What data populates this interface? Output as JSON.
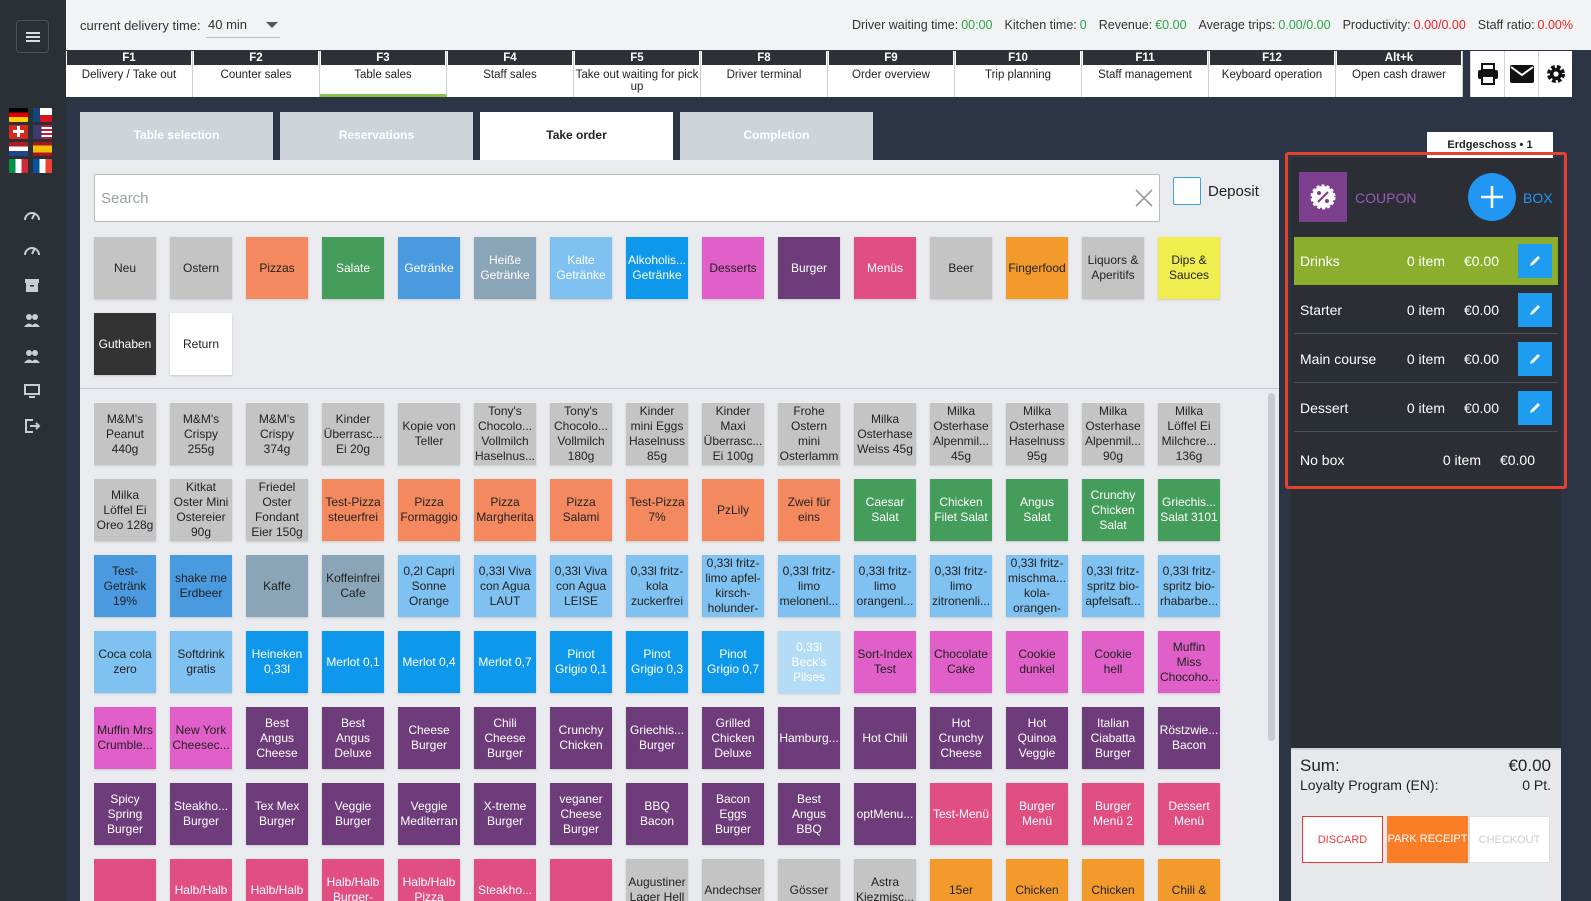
{
  "topbar": {
    "delivery_label": "current delivery time:",
    "delivery_value": "40 min",
    "stats": [
      {
        "label": "Driver waiting time:",
        "value": "00:00",
        "color": "#28a745"
      },
      {
        "label": "Kitchen time:",
        "value": "0",
        "color": "#28a745"
      },
      {
        "label": "Revenue:",
        "value": "€0.00",
        "color": "#28a745"
      },
      {
        "label": "Average trips:",
        "value": "0.00/0.00",
        "color": "#28a745"
      },
      {
        "label": "Productivity:",
        "value": "0.00/0.00",
        "color": "#e02424"
      },
      {
        "label": "Staff ratio:",
        "value": "0.00%",
        "color": "#e02424"
      }
    ]
  },
  "fkeys": [
    {
      "key": "F1",
      "label": "Delivery / Take out"
    },
    {
      "key": "F2",
      "label": "Counter sales"
    },
    {
      "key": "F3",
      "label": "Table sales",
      "active": true
    },
    {
      "key": "F4",
      "label": "Staff sales"
    },
    {
      "key": "F5",
      "label": "Take out waiting for pick up"
    },
    {
      "key": "F8",
      "label": "Driver terminal"
    },
    {
      "key": "F9",
      "label": "Order overview"
    },
    {
      "key": "F10",
      "label": "Trip planning"
    },
    {
      "key": "F11",
      "label": "Staff management"
    },
    {
      "key": "F12",
      "label": "Keyboard operation"
    },
    {
      "key": "Alt+k",
      "label": "Open cash drawer"
    }
  ],
  "top_icons": [
    "printer-icon",
    "mail-icon",
    "gear-icon"
  ],
  "sidebar": {
    "flags": [
      {
        "name": "flag-de",
        "colors": [
          "#000000",
          "#dd0000",
          "#ffce00"
        ],
        "dir": "h"
      },
      {
        "name": "flag-cz",
        "colors": [
          "#ffffff",
          "#d7141a"
        ],
        "dir": "cz"
      },
      {
        "name": "flag-ch",
        "colors": [
          "#d52b1e"
        ],
        "dir": "ch"
      },
      {
        "name": "flag-us",
        "colors": [
          "#b22234",
          "#ffffff",
          "#3c3b6e"
        ],
        "dir": "us"
      },
      {
        "name": "flag-nl",
        "colors": [
          "#ae1c28",
          "#ffffff",
          "#21468b"
        ],
        "dir": "h"
      },
      {
        "name": "flag-es",
        "colors": [
          "#aa151b",
          "#f1bf00",
          "#aa151b"
        ],
        "dir": "es"
      },
      {
        "name": "flag-it",
        "colors": [
          "#009246",
          "#ffffff",
          "#ce2b37"
        ],
        "dir": "v"
      },
      {
        "name": "flag-fr",
        "colors": [
          "#0055a4",
          "#ffffff",
          "#ef4135"
        ],
        "dir": "v"
      }
    ],
    "icons": [
      "speedometer-icon",
      "speedometer-icon",
      "archive-icon",
      "users-icon",
      "users-icon",
      "monitor-icon",
      "logout-icon"
    ]
  },
  "tabs": [
    {
      "label": "Table selection"
    },
    {
      "label": "Reservations"
    },
    {
      "label": "Take order",
      "active": true
    },
    {
      "label": "Completion"
    }
  ],
  "search": {
    "placeholder": "Search",
    "value": ""
  },
  "deposit_label": "Deposit",
  "categories": [
    {
      "label": "Neu",
      "bg": "#c4c4c4",
      "fg": "#222"
    },
    {
      "label": "Ostern",
      "bg": "#c4c4c4",
      "fg": "#222"
    },
    {
      "label": "Pizzas",
      "bg": "#f4895f",
      "fg": "#222"
    },
    {
      "label": "Salate",
      "bg": "#449d5a",
      "fg": "#fff"
    },
    {
      "label": "Getränke",
      "bg": "#4a9ae0",
      "fg": "#fff"
    },
    {
      "label": "Heiße Getränke",
      "bg": "#8aa5b8",
      "fg": "#fff"
    },
    {
      "label": "Kalte Getränke",
      "bg": "#7fc1f0",
      "fg": "#fff"
    },
    {
      "label": "Alkoholis... Getränke",
      "bg": "#0d98ec",
      "fg": "#fff"
    },
    {
      "label": "Desserts",
      "bg": "#e05fc8",
      "fg": "#222"
    },
    {
      "label": "Burger",
      "bg": "#6e3c7a",
      "fg": "#fff"
    },
    {
      "label": "Menüs",
      "bg": "#e04e82",
      "fg": "#fff"
    },
    {
      "label": "Beer",
      "bg": "#c4c4c4",
      "fg": "#222"
    },
    {
      "label": "Fingerfood",
      "bg": "#f39a2d",
      "fg": "#222"
    },
    {
      "label": "Liquors & Aperitifs",
      "bg": "#c4c4c4",
      "fg": "#222"
    },
    {
      "label": "Dips & Sauces",
      "bg": "#f0ee4e",
      "fg": "#222"
    },
    {
      "label": "Guthaben",
      "bg": "#333333",
      "fg": "#fff"
    },
    {
      "label": "Return",
      "bg": "#ffffff",
      "fg": "#222"
    }
  ],
  "products": [
    {
      "label": "M&M's Peanut 440g",
      "bg": "#c4c4c4",
      "fg": "#222"
    },
    {
      "label": "M&M's Crispy 255g",
      "bg": "#c4c4c4",
      "fg": "#222"
    },
    {
      "label": "M&M's Crispy 374g",
      "bg": "#c4c4c4",
      "fg": "#222"
    },
    {
      "label": "Kinder Überrasc... Ei 20g",
      "bg": "#c4c4c4",
      "fg": "#222"
    },
    {
      "label": "Kopie von Teller",
      "bg": "#c4c4c4",
      "fg": "#222"
    },
    {
      "label": "Tony's Chocolo... Vollmilch Haselnus...",
      "bg": "#c4c4c4",
      "fg": "#222"
    },
    {
      "label": "Tony's Chocolo... Vollmilch 180g",
      "bg": "#c4c4c4",
      "fg": "#222"
    },
    {
      "label": "Kinder mini Eggs Haselnuss 85g",
      "bg": "#c4c4c4",
      "fg": "#222"
    },
    {
      "label": "Kinder Maxi Überrasc... Ei 100g",
      "bg": "#c4c4c4",
      "fg": "#222"
    },
    {
      "label": "Frohe Ostern mini Osterlamm",
      "bg": "#c4c4c4",
      "fg": "#222"
    },
    {
      "label": "Milka Osterhase Weiss 45g",
      "bg": "#c4c4c4",
      "fg": "#222"
    },
    {
      "label": "Milka Osterhase Alpenmil... 45g",
      "bg": "#c4c4c4",
      "fg": "#222"
    },
    {
      "label": "Milka Osterhase Haselnuss 95g",
      "bg": "#c4c4c4",
      "fg": "#222"
    },
    {
      "label": "Milka Osterhase Alpenmil... 90g",
      "bg": "#c4c4c4",
      "fg": "#222"
    },
    {
      "label": "Milka Löffel Ei Milchcre... 136g",
      "bg": "#c4c4c4",
      "fg": "#222"
    },
    {
      "label": "Milka Löffel Ei Oreo 128g",
      "bg": "#c4c4c4",
      "fg": "#222"
    },
    {
      "label": "Kitkat Oster Mini Ostereier 90g",
      "bg": "#c4c4c4",
      "fg": "#222"
    },
    {
      "label": "Friedel Oster Fondant Eier 150g",
      "bg": "#c4c4c4",
      "fg": "#222"
    },
    {
      "label": "Test-Pizza steuerfrei",
      "bg": "#f4895f",
      "fg": "#222"
    },
    {
      "label": "Pizza Formaggio",
      "bg": "#f4895f",
      "fg": "#222"
    },
    {
      "label": "Pizza Margherita",
      "bg": "#f4895f",
      "fg": "#222"
    },
    {
      "label": "Pizza Salami",
      "bg": "#f4895f",
      "fg": "#222"
    },
    {
      "label": "Test-Pizza 7%",
      "bg": "#f4895f",
      "fg": "#222"
    },
    {
      "label": "PzLily",
      "bg": "#f4895f",
      "fg": "#222"
    },
    {
      "label": "Zwei für eins",
      "bg": "#f4895f",
      "fg": "#222"
    },
    {
      "label": "Caesar Salat",
      "bg": "#449d5a",
      "fg": "#fff"
    },
    {
      "label": "Chicken Filet Salat",
      "bg": "#449d5a",
      "fg": "#fff"
    },
    {
      "label": "Angus Salat",
      "bg": "#449d5a",
      "fg": "#fff"
    },
    {
      "label": "Crunchy Chicken Salat",
      "bg": "#449d5a",
      "fg": "#fff"
    },
    {
      "label": "Griechis... Salat 3101",
      "bg": "#449d5a",
      "fg": "#fff"
    },
    {
      "label": "Test-Getränk 19%",
      "bg": "#4a9ae0",
      "fg": "#222"
    },
    {
      "label": "shake me Erdbeer",
      "bg": "#4a9ae0",
      "fg": "#222"
    },
    {
      "label": "Kaffe",
      "bg": "#8aa5b8",
      "fg": "#222"
    },
    {
      "label": "Koffeinfrei Cafe",
      "bg": "#8aa5b8",
      "fg": "#222"
    },
    {
      "label": "0,2l Capri Sonne Orange",
      "bg": "#7fc1f0",
      "fg": "#222"
    },
    {
      "label": "0,33l Viva con Agua LAUT",
      "bg": "#7fc1f0",
      "fg": "#222"
    },
    {
      "label": "0,33l Viva con Agua LEISE",
      "bg": "#7fc1f0",
      "fg": "#222"
    },
    {
      "label": "0,33l fritz-kola zuckerfrei",
      "bg": "#7fc1f0",
      "fg": "#222"
    },
    {
      "label": "0,33l fritz-limo apfel-kirsch-holunder-",
      "bg": "#7fc1f0",
      "fg": "#222"
    },
    {
      "label": "0,33l fritz-limo melonenl...",
      "bg": "#7fc1f0",
      "fg": "#222"
    },
    {
      "label": "0,33l fritz-limo orangenl...",
      "bg": "#7fc1f0",
      "fg": "#222"
    },
    {
      "label": "0,33l fritz-limo zitronenli...",
      "bg": "#7fc1f0",
      "fg": "#222"
    },
    {
      "label": "0,33l fritz-mischma... kola-orangen-",
      "bg": "#7fc1f0",
      "fg": "#222"
    },
    {
      "label": "0,33l fritz-spritz bio-apfelsaft...",
      "bg": "#7fc1f0",
      "fg": "#222"
    },
    {
      "label": "0,33l fritz-spritz bio-rhabarbe...",
      "bg": "#7fc1f0",
      "fg": "#222"
    },
    {
      "label": "Coca cola zero",
      "bg": "#7fc1f0",
      "fg": "#222"
    },
    {
      "label": "Softdrink gratis",
      "bg": "#7fc1f0",
      "fg": "#222"
    },
    {
      "label": "Heineken 0,33l",
      "bg": "#0d98ec",
      "fg": "#fff"
    },
    {
      "label": "Merlot 0,1",
      "bg": "#0d98ec",
      "fg": "#fff"
    },
    {
      "label": "Merlot 0,4",
      "bg": "#0d98ec",
      "fg": "#fff"
    },
    {
      "label": "Merlot 0,7",
      "bg": "#0d98ec",
      "fg": "#fff"
    },
    {
      "label": "Pinot Grigio 0,1",
      "bg": "#0d98ec",
      "fg": "#fff"
    },
    {
      "label": "Pinot Grigio 0,3",
      "bg": "#0d98ec",
      "fg": "#fff"
    },
    {
      "label": "Pinot Grigio 0,7",
      "bg": "#0d98ec",
      "fg": "#fff"
    },
    {
      "label": "0,33l Beck's Pilses",
      "bg": "#b5dcf7",
      "fg": "#fff"
    },
    {
      "label": "Sort-Index Test",
      "bg": "#e05fc8",
      "fg": "#222"
    },
    {
      "label": "Chocolate Cake",
      "bg": "#e05fc8",
      "fg": "#222"
    },
    {
      "label": "Cookie dunkel",
      "bg": "#e05fc8",
      "fg": "#222"
    },
    {
      "label": "Cookie hell",
      "bg": "#e05fc8",
      "fg": "#222"
    },
    {
      "label": "Muffin Miss Chocoho...",
      "bg": "#e05fc8",
      "fg": "#222"
    },
    {
      "label": "Muffin Mrs Crumble...",
      "bg": "#e05fc8",
      "fg": "#222"
    },
    {
      "label": "New York Cheesec...",
      "bg": "#e05fc8",
      "fg": "#222"
    },
    {
      "label": "Best Angus Cheese",
      "bg": "#6e3c7a",
      "fg": "#fff"
    },
    {
      "label": "Best Angus Deluxe",
      "bg": "#6e3c7a",
      "fg": "#fff"
    },
    {
      "label": "Cheese Burger",
      "bg": "#6e3c7a",
      "fg": "#fff"
    },
    {
      "label": "Chili Cheese Burger",
      "bg": "#6e3c7a",
      "fg": "#fff"
    },
    {
      "label": "Crunchy Chicken",
      "bg": "#6e3c7a",
      "fg": "#fff"
    },
    {
      "label": "Griechis... Burger",
      "bg": "#6e3c7a",
      "fg": "#fff"
    },
    {
      "label": "Grilled Chicken Deluxe",
      "bg": "#6e3c7a",
      "fg": "#fff"
    },
    {
      "label": "Hamburg...",
      "bg": "#6e3c7a",
      "fg": "#fff"
    },
    {
      "label": "Hot Chili",
      "bg": "#6e3c7a",
      "fg": "#fff"
    },
    {
      "label": "Hot Crunchy Cheese",
      "bg": "#6e3c7a",
      "fg": "#fff"
    },
    {
      "label": "Hot Quinoa Veggie",
      "bg": "#6e3c7a",
      "fg": "#fff"
    },
    {
      "label": "Italian Ciabatta Burger",
      "bg": "#6e3c7a",
      "fg": "#fff"
    },
    {
      "label": "Röstzwie... Bacon",
      "bg": "#6e3c7a",
      "fg": "#fff"
    },
    {
      "label": "Spicy Spring Burger",
      "bg": "#6e3c7a",
      "fg": "#fff"
    },
    {
      "label": "Steakho... Burger",
      "bg": "#6e3c7a",
      "fg": "#fff"
    },
    {
      "label": "Tex Mex Burger",
      "bg": "#6e3c7a",
      "fg": "#fff"
    },
    {
      "label": "Veggie Burger",
      "bg": "#6e3c7a",
      "fg": "#fff"
    },
    {
      "label": "Veggie Mediterran",
      "bg": "#6e3c7a",
      "fg": "#fff"
    },
    {
      "label": "X-treme Burger",
      "bg": "#6e3c7a",
      "fg": "#fff"
    },
    {
      "label": "veganer Cheese Burger",
      "bg": "#6e3c7a",
      "fg": "#fff"
    },
    {
      "label": "BBQ Bacon",
      "bg": "#6e3c7a",
      "fg": "#fff"
    },
    {
      "label": "Bacon Eggs Burger",
      "bg": "#6e3c7a",
      "fg": "#fff"
    },
    {
      "label": "Best Angus BBQ",
      "bg": "#6e3c7a",
      "fg": "#fff"
    },
    {
      "label": "optMenu...",
      "bg": "#6e3c7a",
      "fg": "#fff"
    },
    {
      "label": "Test-Menü",
      "bg": "#e04e82",
      "fg": "#fff"
    },
    {
      "label": "Burger Menü",
      "bg": "#e04e82",
      "fg": "#fff"
    },
    {
      "label": "Burger Menü 2",
      "bg": "#e04e82",
      "fg": "#fff"
    },
    {
      "label": "Dessert Menü",
      "bg": "#e04e82",
      "fg": "#fff"
    },
    {
      "label": "",
      "bg": "#e04e82",
      "fg": "#fff"
    },
    {
      "label": "Halb/Halb",
      "bg": "#e04e82",
      "fg": "#fff"
    },
    {
      "label": "Halb/Halb",
      "bg": "#e04e82",
      "fg": "#fff"
    },
    {
      "label": "Halb/Halb Burger-",
      "bg": "#e04e82",
      "fg": "#fff"
    },
    {
      "label": "Halb/Halb Pizza",
      "bg": "#e04e82",
      "fg": "#fff"
    },
    {
      "label": "Steakho...",
      "bg": "#e04e82",
      "fg": "#fff"
    },
    {
      "label": "",
      "bg": "#e04e82",
      "fg": "#fff"
    },
    {
      "label": "Augustiner Lager Hell",
      "bg": "#c4c4c4",
      "fg": "#222"
    },
    {
      "label": "Andechser",
      "bg": "#c4c4c4",
      "fg": "#222"
    },
    {
      "label": "Gösser",
      "bg": "#c4c4c4",
      "fg": "#222"
    },
    {
      "label": "Astra Kiezmisc...",
      "bg": "#c4c4c4",
      "fg": "#222"
    },
    {
      "label": "15er",
      "bg": "#f39a2d",
      "fg": "#222"
    },
    {
      "label": "Chicken",
      "bg": "#f39a2d",
      "fg": "#222"
    },
    {
      "label": "Chicken",
      "bg": "#f39a2d",
      "fg": "#222"
    },
    {
      "label": "Chili &",
      "bg": "#f39a2d",
      "fg": "#222"
    }
  ],
  "right_panel": {
    "floor_tab": "Erdgeschoss • 1",
    "coupon_label": "COUPON",
    "box_label": "BOX",
    "courses": [
      {
        "name": "Drinks",
        "count": "0 item",
        "price": "€0.00",
        "active": true
      },
      {
        "name": "Starter",
        "count": "0 item",
        "price": "€0.00"
      },
      {
        "name": "Main course",
        "count": "0 item",
        "price": "€0.00"
      },
      {
        "name": "Dessert",
        "count": "0 item",
        "price": "€0.00"
      }
    ],
    "no_box": {
      "name": "No box",
      "count": "0 item",
      "price": "€0.00"
    },
    "sum_label": "Sum:",
    "sum_value": "€0.00",
    "loyalty_label": "Loyalty Program (EN):",
    "loyalty_value": "0 Pt.",
    "discard_label": "DISCARD",
    "park_label": "PARK RECEIPT",
    "checkout_label": "CHECKOUT"
  }
}
